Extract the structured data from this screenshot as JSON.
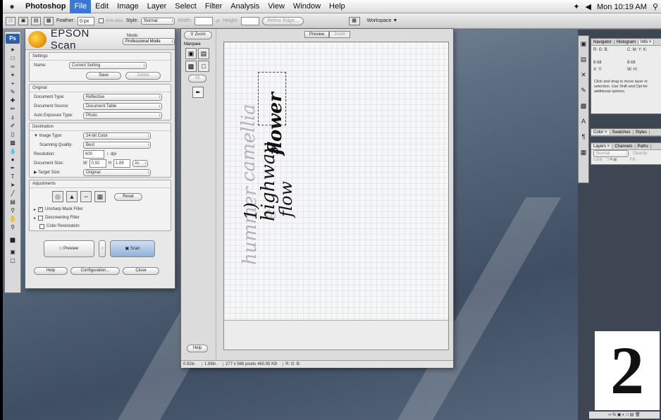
{
  "menubar": {
    "app": "Photoshop",
    "items": [
      "File",
      "Edit",
      "Image",
      "Layer",
      "Select",
      "Filter",
      "Analysis",
      "View",
      "Window",
      "Help"
    ],
    "clock": "Mon 10:19 AM"
  },
  "options": {
    "feather_label": "Feather:",
    "feather_value": "0 px",
    "anti_alias": "Anti-alias",
    "style_label": "Style:",
    "style_value": "Normal",
    "width_label": "Width:",
    "height_label": "Height:",
    "refine_edge": "Refine Edge...",
    "workspace": "Workspace ▼"
  },
  "toolbox": {
    "badge": "Ps"
  },
  "epson": {
    "brand": "EPSON Scan",
    "mode_label": "Mode:",
    "mode_value": "Professional Mode",
    "settings": {
      "title": "Settings",
      "name_label": "Name:",
      "name_value": "Current Setting",
      "save": "Save",
      "delete": "Delete"
    },
    "original": {
      "title": "Original",
      "doc_type_label": "Document Type:",
      "doc_type": "Reflective",
      "doc_source_label": "Document Source:",
      "doc_source": "Document Table",
      "auto_exposure_label": "Auto Exposure Type:",
      "auto_exposure": "Photo"
    },
    "destination": {
      "title": "Destination",
      "image_type_label": "▼ Image Type:",
      "image_type": "24-bit Color",
      "quality_label": "Scanning Quality:",
      "quality": "Best",
      "resolution_label": "Resolution:",
      "resolution": "600",
      "dpi": "dpi",
      "doc_size_label": "Document Size:",
      "w_label": "W",
      "w_value": "0.92",
      "h_label": "H",
      "h_value": "1.89",
      "units": "in.",
      "target_size_label": "▶ Target Size:",
      "target_size": "Original"
    },
    "adjustments": {
      "title": "Adjustments",
      "reset": "Reset",
      "unsharp": "Unsharp Mask Filter",
      "descreening": "Descreening Filter",
      "color_restoration": "Color Restoration"
    },
    "buttons": {
      "preview": "Preview",
      "scan": "Scan",
      "help": "Help",
      "configuration": "Configuration...",
      "close": "Close"
    }
  },
  "preview": {
    "zoom_button": "Zoom",
    "marquee_label": "Marquee",
    "all_button": "All",
    "help_button": "Help",
    "tabs": [
      "Preview",
      "Zoom"
    ],
    "handwriting": [
      "hummer",
      "camellia",
      "e",
      "1)",
      "highway",
      "flower",
      "flow"
    ],
    "status": {
      "width": "0.92in.",
      "height": "1.89in.",
      "pixels": "277 x 568 pixels 460.95 KB",
      "rgb": "R: G: B:"
    }
  },
  "panels": {
    "info": {
      "tabs": [
        "Navigator",
        "Histogram",
        "Info ×"
      ],
      "rgb": "R: G: B:",
      "cmyk": "C: M: Y: K:",
      "bit_left": "8-bit",
      "bit_right": "8-bit",
      "xy": "X: Y:",
      "wh": "W: H:",
      "help": "Click and drag to move layer or selection. Use Shift and Opt for additional options."
    },
    "color": {
      "tabs": [
        "Color ×",
        "Swatches",
        "Styles"
      ]
    },
    "layers": {
      "tabs": [
        "Layers ×",
        "Channels",
        "Paths"
      ],
      "blend": "Normal",
      "opacity": "Opacity:",
      "lock": "Lock:",
      "fill": "Fill:"
    }
  },
  "overlay": {
    "step_number": "2"
  }
}
